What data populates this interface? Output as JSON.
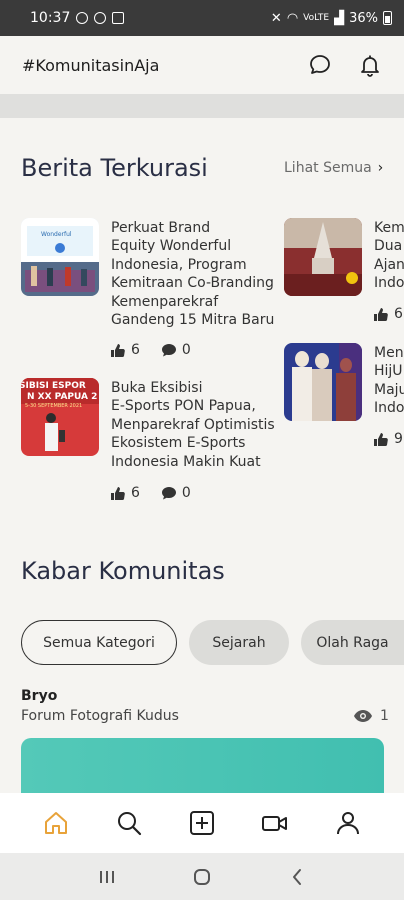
{
  "status_bar": {
    "time": "10:37",
    "battery": "36%",
    "signal_text": "VoLTE"
  },
  "header": {
    "title": "#KomunitasinAja",
    "icons": [
      "chat-bubble-icon",
      "bell-icon"
    ]
  },
  "berita": {
    "title": "Berita Terkurasi",
    "see_all": "Lihat Semua",
    "items": [
      {
        "lines": [
          "Perkuat Brand",
          "Equity Wonderful",
          "Indonesia, Program",
          "Kemitraan Co-Branding",
          "Kemenparekraf",
          "Gandeng 15 Mitra Baru"
        ],
        "likes": "6",
        "comments": "0"
      },
      {
        "lines": [
          "Kem",
          "Dua",
          "Ajan",
          "Indo"
        ],
        "likes": "6"
      },
      {
        "lines": [
          "Buka Eksibisi",
          "E-Sports PON Papua,",
          "Menparekraf Optimistis",
          "Ekosistem E-Sports",
          "Indonesia Makin Kuat"
        ],
        "likes": "6",
        "comments": "0",
        "thumb_text": [
          "SIBISI ESPOR",
          "N XX PAPUA 2",
          "5-30 SEPTEMBER 2021"
        ]
      },
      {
        "lines": [
          "Men",
          "HijU",
          "Maju",
          "Indo"
        ],
        "likes": "9"
      }
    ]
  },
  "kabar": {
    "title": "Kabar Komunitas",
    "chips": [
      "Semua Kategori",
      "Sejarah",
      "Olah Raga"
    ],
    "post": {
      "author": "Bryo",
      "community": "Forum Fotografi Kudus",
      "views": "1"
    }
  },
  "bottom_nav": [
    "home-icon",
    "search-icon",
    "add-post-icon",
    "video-icon",
    "profile-icon"
  ],
  "colors": {
    "accent_home": "#e8a33a",
    "background": "#f5f4f1",
    "post_image": "#4cc5b5"
  }
}
